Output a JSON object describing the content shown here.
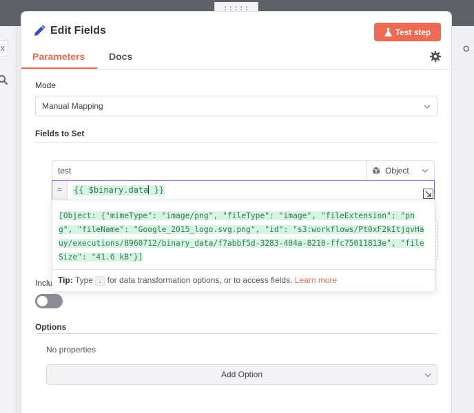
{
  "drag_handle": ":::::",
  "left_close": "x",
  "right_panel_letters": "O U",
  "header": {
    "title": "Edit Fields",
    "test_step_label": "Test step"
  },
  "tabs": [
    {
      "label": "Parameters",
      "active": true
    },
    {
      "label": "Docs",
      "active": false
    }
  ],
  "mode": {
    "label": "Mode",
    "value": "Manual Mapping"
  },
  "fields_to_set": {
    "label": "Fields to Set",
    "field": {
      "name": "test",
      "type": "Object",
      "expression_prefix": "=",
      "expression_before_cursor": "{{ $binary.data",
      "expression_after_cursor": " }}"
    }
  },
  "expression_popup": {
    "result": "[Object: {\"mimeType\": \"image/png\", \"fileType\": \"image\", \"fileExtension\": \"png\", \"fileName\": \"Google_2015_logo.svg.png\", \"id\": \"s3:workflows/Pt0xF2kItjqvHauy/executions/8960712/binary_data/f7abbf5d-3283-404a-8210-ffc75011813e\", \"fileSize\": \"41.6 kB\"}]",
    "tip": {
      "label": "Tip:",
      "text_before": "Type",
      "key": ".",
      "text_after": "for data transformation options, or to access fields.",
      "link": "Learn more"
    }
  },
  "include": {
    "label_visible": "Inclu",
    "enabled": false
  },
  "options": {
    "label": "Options",
    "empty_text": "No properties",
    "add_option_label": "Add Option"
  },
  "colors": {
    "accent": "#ef6a53",
    "expression_border": "#7a69d2",
    "resolved_text": "#2e7d4f",
    "resolved_bg": "#d8f3e3"
  },
  "icons": {
    "title": "pencil-icon",
    "test_step": "flask-icon",
    "settings": "gear-icon",
    "type": "cube-icon",
    "expand": "expand-icon"
  }
}
